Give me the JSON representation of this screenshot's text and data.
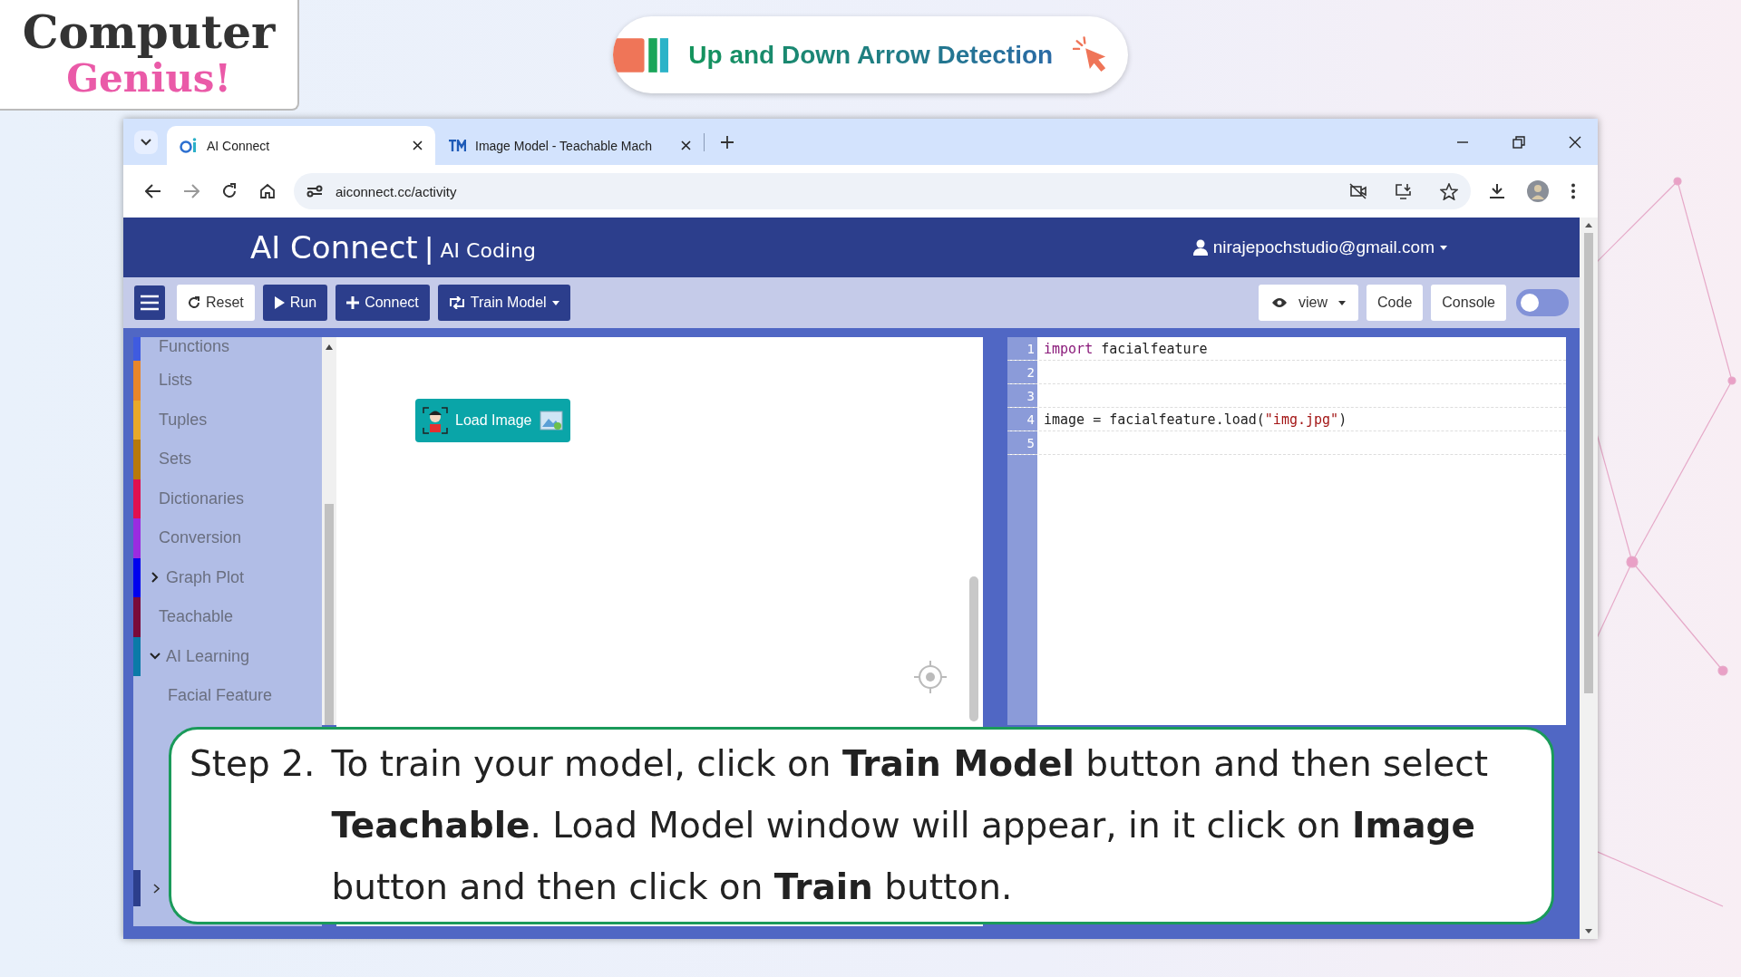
{
  "logo": {
    "line_1": "Computer",
    "line_2": "Genius!"
  },
  "title_pill": {
    "text": "Up and Down Arrow Detection"
  },
  "browser": {
    "tabs": [
      {
        "title": "AI Connect",
        "selected": true
      },
      {
        "title": "Image Model - Teachable Mach",
        "selected": false
      }
    ],
    "address": "aiconnect.cc/activity"
  },
  "app": {
    "brand": "AI Connect",
    "separator": "|",
    "subtitle": "AI Coding",
    "user": "nirajepochstudio@gmail.com",
    "toolbar": [
      {
        "label": "Reset",
        "kind": "reset"
      },
      {
        "label": "Run",
        "kind": "run"
      },
      {
        "label": "Connect",
        "kind": "connect"
      },
      {
        "label": "Train Model",
        "kind": "train"
      }
    ],
    "view_button": "view",
    "panel_buttons": [
      "Code",
      "Console"
    ],
    "toggle": {
      "on": false
    },
    "categories": [
      {
        "label": "Functions",
        "color": "#3f5be0"
      },
      {
        "label": "Lists",
        "color": "#e8862a"
      },
      {
        "label": "Tuples",
        "color": "#e8a92a"
      },
      {
        "label": "Sets",
        "color": "#b8790a"
      },
      {
        "label": "Dictionaries",
        "color": "#e0104f"
      },
      {
        "label": "Conversion",
        "color": "#9a2be0"
      },
      {
        "label": "Graph Plot",
        "color": "#0000ee",
        "expanded": false
      },
      {
        "label": "Teachable",
        "color": "#7a0a3a"
      },
      {
        "label": "AI Learning",
        "color": "#0a7aa8",
        "expanded": true,
        "children": [
          {
            "label": "Facial Feature"
          }
        ]
      }
    ],
    "block": {
      "label": "Load Image"
    },
    "code_lines": [
      {
        "number": "1",
        "tokens": [
          {
            "kind": "keyword",
            "text": "import"
          },
          {
            "kind": "plain",
            "text": " facialfeature"
          }
        ]
      },
      {
        "number": "2"
      },
      {
        "number": "3"
      },
      {
        "number": "4",
        "tokens": [
          {
            "kind": "plain",
            "text": "image = facialfeature.load("
          },
          {
            "kind": "string",
            "text": "\"img.jpg\""
          },
          {
            "kind": "plain",
            "text": ")"
          }
        ]
      },
      {
        "number": "5"
      }
    ]
  },
  "caption": {
    "step": "Step 2.",
    "text": "To train your model, click on **Train Model** button and then select **Teachable**. Load Model window will appear, in it click on **Image** button and then click on **Train** button."
  }
}
